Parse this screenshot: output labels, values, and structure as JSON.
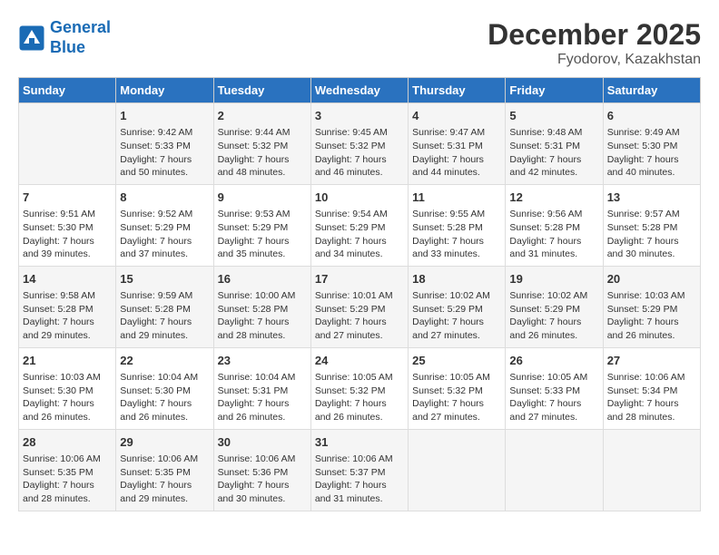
{
  "header": {
    "logo_line1": "General",
    "logo_line2": "Blue",
    "title": "December 2025",
    "subtitle": "Fyodorov, Kazakhstan"
  },
  "columns": [
    "Sunday",
    "Monday",
    "Tuesday",
    "Wednesday",
    "Thursday",
    "Friday",
    "Saturday"
  ],
  "weeks": [
    [
      {
        "day": "",
        "info": ""
      },
      {
        "day": "1",
        "info": "Sunrise: 9:42 AM\nSunset: 5:33 PM\nDaylight: 7 hours\nand 50 minutes."
      },
      {
        "day": "2",
        "info": "Sunrise: 9:44 AM\nSunset: 5:32 PM\nDaylight: 7 hours\nand 48 minutes."
      },
      {
        "day": "3",
        "info": "Sunrise: 9:45 AM\nSunset: 5:32 PM\nDaylight: 7 hours\nand 46 minutes."
      },
      {
        "day": "4",
        "info": "Sunrise: 9:47 AM\nSunset: 5:31 PM\nDaylight: 7 hours\nand 44 minutes."
      },
      {
        "day": "5",
        "info": "Sunrise: 9:48 AM\nSunset: 5:31 PM\nDaylight: 7 hours\nand 42 minutes."
      },
      {
        "day": "6",
        "info": "Sunrise: 9:49 AM\nSunset: 5:30 PM\nDaylight: 7 hours\nand 40 minutes."
      }
    ],
    [
      {
        "day": "7",
        "info": "Sunrise: 9:51 AM\nSunset: 5:30 PM\nDaylight: 7 hours\nand 39 minutes."
      },
      {
        "day": "8",
        "info": "Sunrise: 9:52 AM\nSunset: 5:29 PM\nDaylight: 7 hours\nand 37 minutes."
      },
      {
        "day": "9",
        "info": "Sunrise: 9:53 AM\nSunset: 5:29 PM\nDaylight: 7 hours\nand 35 minutes."
      },
      {
        "day": "10",
        "info": "Sunrise: 9:54 AM\nSunset: 5:29 PM\nDaylight: 7 hours\nand 34 minutes."
      },
      {
        "day": "11",
        "info": "Sunrise: 9:55 AM\nSunset: 5:28 PM\nDaylight: 7 hours\nand 33 minutes."
      },
      {
        "day": "12",
        "info": "Sunrise: 9:56 AM\nSunset: 5:28 PM\nDaylight: 7 hours\nand 31 minutes."
      },
      {
        "day": "13",
        "info": "Sunrise: 9:57 AM\nSunset: 5:28 PM\nDaylight: 7 hours\nand 30 minutes."
      }
    ],
    [
      {
        "day": "14",
        "info": "Sunrise: 9:58 AM\nSunset: 5:28 PM\nDaylight: 7 hours\nand 29 minutes."
      },
      {
        "day": "15",
        "info": "Sunrise: 9:59 AM\nSunset: 5:28 PM\nDaylight: 7 hours\nand 29 minutes."
      },
      {
        "day": "16",
        "info": "Sunrise: 10:00 AM\nSunset: 5:28 PM\nDaylight: 7 hours\nand 28 minutes."
      },
      {
        "day": "17",
        "info": "Sunrise: 10:01 AM\nSunset: 5:29 PM\nDaylight: 7 hours\nand 27 minutes."
      },
      {
        "day": "18",
        "info": "Sunrise: 10:02 AM\nSunset: 5:29 PM\nDaylight: 7 hours\nand 27 minutes."
      },
      {
        "day": "19",
        "info": "Sunrise: 10:02 AM\nSunset: 5:29 PM\nDaylight: 7 hours\nand 26 minutes."
      },
      {
        "day": "20",
        "info": "Sunrise: 10:03 AM\nSunset: 5:29 PM\nDaylight: 7 hours\nand 26 minutes."
      }
    ],
    [
      {
        "day": "21",
        "info": "Sunrise: 10:03 AM\nSunset: 5:30 PM\nDaylight: 7 hours\nand 26 minutes."
      },
      {
        "day": "22",
        "info": "Sunrise: 10:04 AM\nSunset: 5:30 PM\nDaylight: 7 hours\nand 26 minutes."
      },
      {
        "day": "23",
        "info": "Sunrise: 10:04 AM\nSunset: 5:31 PM\nDaylight: 7 hours\nand 26 minutes."
      },
      {
        "day": "24",
        "info": "Sunrise: 10:05 AM\nSunset: 5:32 PM\nDaylight: 7 hours\nand 26 minutes."
      },
      {
        "day": "25",
        "info": "Sunrise: 10:05 AM\nSunset: 5:32 PM\nDaylight: 7 hours\nand 27 minutes."
      },
      {
        "day": "26",
        "info": "Sunrise: 10:05 AM\nSunset: 5:33 PM\nDaylight: 7 hours\nand 27 minutes."
      },
      {
        "day": "27",
        "info": "Sunrise: 10:06 AM\nSunset: 5:34 PM\nDaylight: 7 hours\nand 28 minutes."
      }
    ],
    [
      {
        "day": "28",
        "info": "Sunrise: 10:06 AM\nSunset: 5:35 PM\nDaylight: 7 hours\nand 28 minutes."
      },
      {
        "day": "29",
        "info": "Sunrise: 10:06 AM\nSunset: 5:35 PM\nDaylight: 7 hours\nand 29 minutes."
      },
      {
        "day": "30",
        "info": "Sunrise: 10:06 AM\nSunset: 5:36 PM\nDaylight: 7 hours\nand 30 minutes."
      },
      {
        "day": "31",
        "info": "Sunrise: 10:06 AM\nSunset: 5:37 PM\nDaylight: 7 hours\nand 31 minutes."
      },
      {
        "day": "",
        "info": ""
      },
      {
        "day": "",
        "info": ""
      },
      {
        "day": "",
        "info": ""
      }
    ]
  ]
}
